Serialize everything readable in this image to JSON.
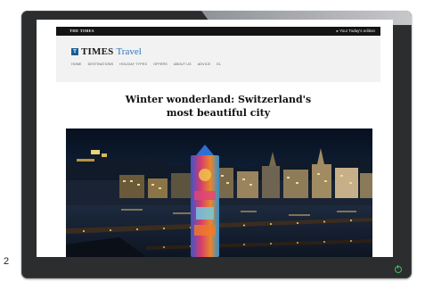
{
  "page_number": "2",
  "site": {
    "masthead": "THE TIMES",
    "top_link": "▸ Your Today's edition",
    "brand_prefix": "TIMES",
    "brand_suffix": "Travel",
    "logo_badge": "T"
  },
  "nav": [
    "HOME",
    "DESTINATIONS",
    "HOLIDAY TYPES",
    "OFFERS",
    "ABOUT US",
    "ADVICE",
    "EL"
  ],
  "article": {
    "headline_line1": "Winter wonderland: Switzerland's",
    "headline_line2": "most beautiful city"
  },
  "colors": {
    "brand_blue": "#2a78c2",
    "power_led": "#3fbf60",
    "monitor_bezel": "#2b2d2f"
  }
}
